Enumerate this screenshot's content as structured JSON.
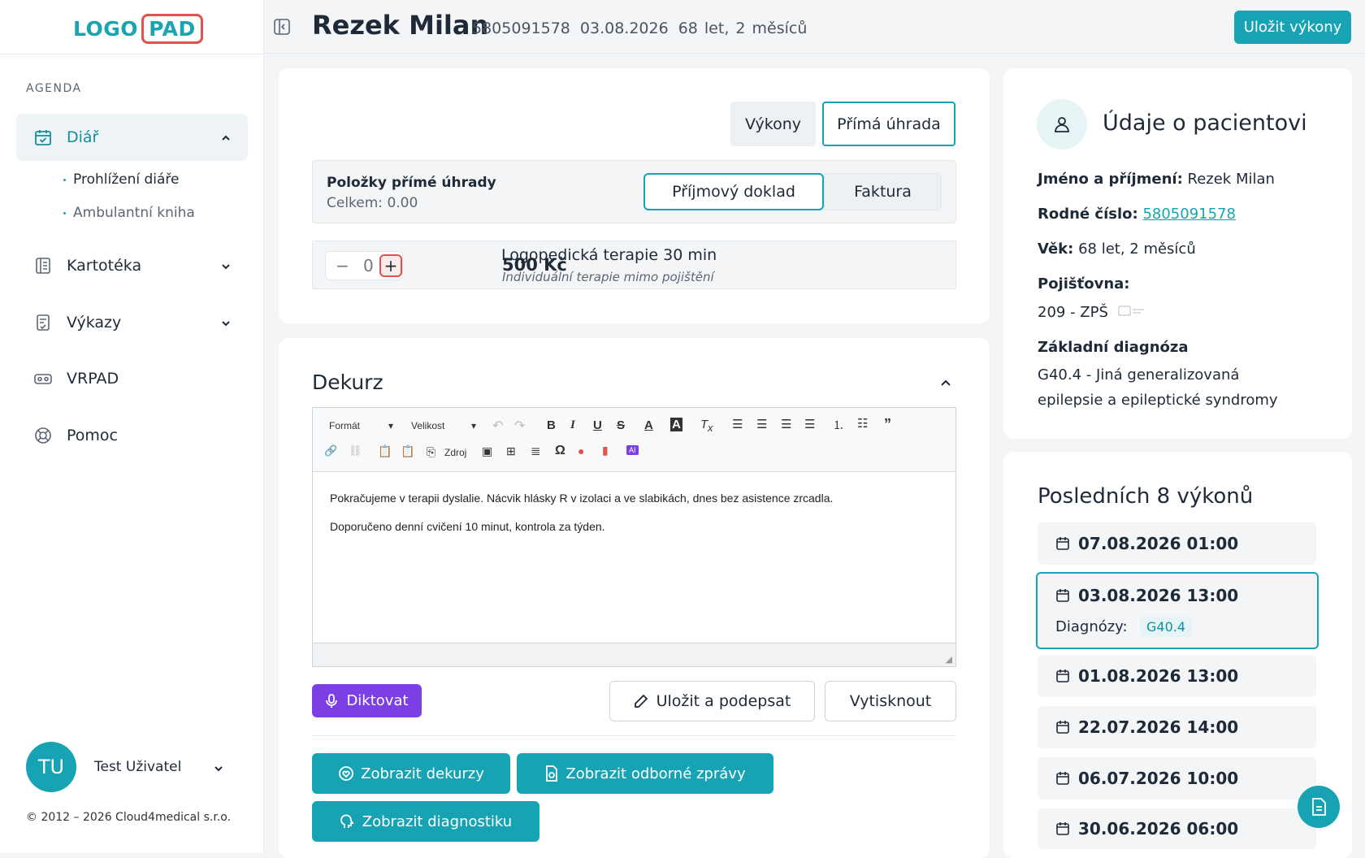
{
  "logo": {
    "part1": "LOGO",
    "part2": "PAD"
  },
  "sidebar": {
    "section_title": "AGENDA",
    "items": [
      {
        "label": "Diář",
        "icon": "calendar-icon"
      },
      {
        "label": "Kartotéka",
        "icon": "book-icon"
      },
      {
        "label": "Výkazy",
        "icon": "report-icon"
      },
      {
        "label": "VRPAD",
        "icon": "vr-headset-icon"
      },
      {
        "label": "Pomoc",
        "icon": "lifebuoy-icon"
      }
    ],
    "sub_items": [
      {
        "label": "Prohlížení diáře"
      },
      {
        "label": "Ambulantní kniha"
      }
    ]
  },
  "user": {
    "initials": "TU",
    "name": "Test Uživatel"
  },
  "copyright": "© 2012 – 2026 Cloud4medical s.r.o.",
  "header": {
    "name": "Rezek Milan",
    "birth_number": "5805091578",
    "date": "03.08.2026",
    "age": "68 let, 2 měsíců",
    "save_label": "Uložit výkony"
  },
  "tabs": {
    "vykony": "Výkony",
    "prima": "Přímá úhrada"
  },
  "direct_payment": {
    "title": "Položky přímé úhrady",
    "total": "Celkem: 0.00",
    "receipt": "Příjmový doklad",
    "invoice": "Faktura",
    "item": {
      "qty": "0",
      "minus": "−",
      "plus": "+",
      "price": "500 Kč",
      "name": "Logopedická terapie 30 min",
      "note": "Individuální terapie mimo pojištění"
    }
  },
  "dekurz": {
    "title": "Dekurz",
    "toolbar": {
      "format": "Formát",
      "size": "Velikost",
      "source": "Zdroj"
    },
    "text1": "Pokračujeme v terapii dyslalie. Nácvik hlásky R v izolaci a ve slabikách, dnes bez asistence zrcadla.",
    "text2": "Doporučeno denní cvičení 10 minut, kontrola za týden.",
    "dictate": "Diktovat",
    "save_sign": "Uložit a podepsat",
    "print": "Vytisknout",
    "show_dekurzy": "Zobrazit dekurzy",
    "show_reports": "Zobrazit odborné zprávy",
    "show_diag": "Zobrazit diagnostiku"
  },
  "patient": {
    "title": "Údaje o pacientovi",
    "name_label": "Jméno a příjmení:",
    "name": "Rezek Milan",
    "rc_label": "Rodné číslo:",
    "rc": "5805091578",
    "age_label": "Věk:",
    "age": "68 let, 2 měsíců",
    "ins_label": "Pojišťovna:",
    "ins": "209 - ZPŠ",
    "diag_label": "Základní diagnóza",
    "diag": "G40.4 - Jiná generalizovaná epilepsie a epileptické syndromy"
  },
  "recent": {
    "title": "Posledních 8 výkonů",
    "items": [
      "07.08.2026 01:00",
      "03.08.2026 13:00",
      "01.08.2026 13:00",
      "22.07.2026 14:00",
      "06.07.2026 10:00",
      "30.06.2026 06:00"
    ],
    "diag_label": "Diagnózy:",
    "diag_code": "G40.4"
  },
  "colors": {
    "accent": "#17a3b3",
    "purple": "#7b3fe4",
    "logo_red": "#e0524b"
  }
}
